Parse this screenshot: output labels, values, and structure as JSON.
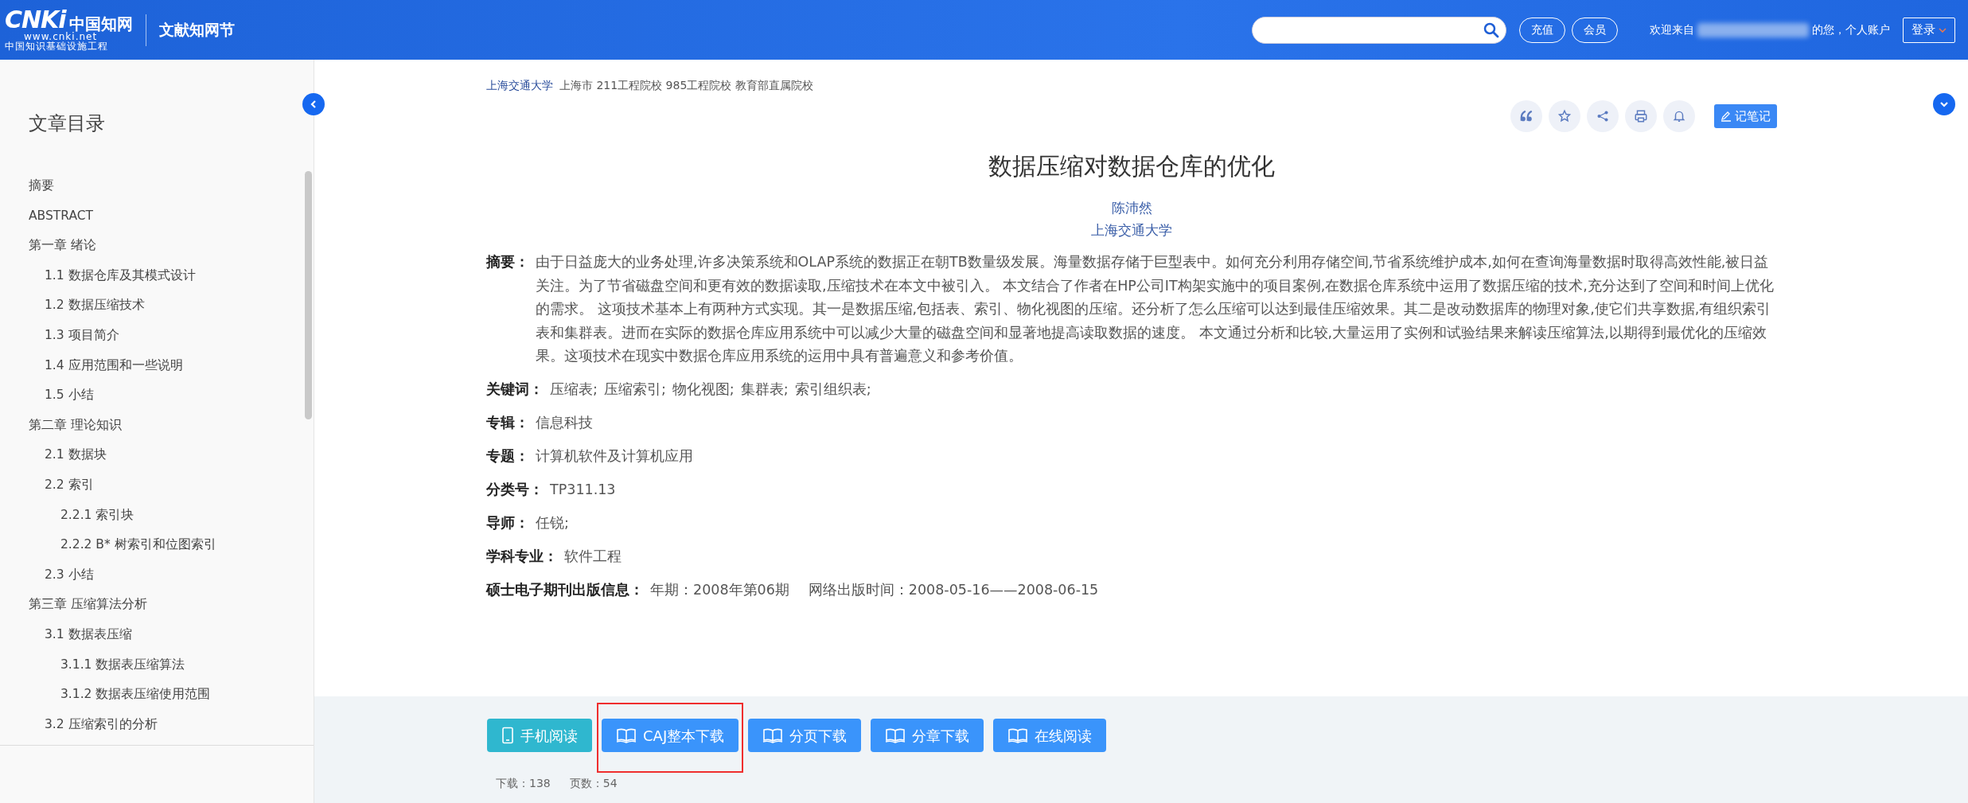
{
  "header": {
    "logo": {
      "mark": "CNKi",
      "name": "中国知网",
      "url": "www.cnki.net",
      "slogan": "中国知识基础设施工程"
    },
    "section": "文献知网节",
    "buttons": [
      "充值",
      "会员"
    ],
    "welcome": "欢迎来自",
    "welcome_suffix": "的您，个人账户",
    "login": "登录"
  },
  "sidebar": {
    "title": "文章目录",
    "items": [
      {
        "label": "摘要"
      },
      {
        "label": "ABSTRACT"
      },
      {
        "label": "第一章 绪论",
        "children": [
          {
            "label": "1.1 数据仓库及其模式设计"
          },
          {
            "label": "1.2 数据压缩技术"
          },
          {
            "label": "1.3 项目简介"
          },
          {
            "label": "1.4 应用范围和一些说明"
          },
          {
            "label": "1.5 小结"
          }
        ]
      },
      {
        "label": "第二章 理论知识",
        "children": [
          {
            "label": "2.1 数据块"
          },
          {
            "label": "2.2 索引",
            "children": [
              {
                "label": "2.2.1 索引块"
              },
              {
                "label": "2.2.2 B* 树索引和位图索引"
              }
            ]
          },
          {
            "label": "2.3 小结"
          }
        ]
      },
      {
        "label": "第三章 压缩算法分析",
        "children": [
          {
            "label": "3.1 数据表压缩",
            "children": [
              {
                "label": "3.1.1 数据表压缩算法"
              },
              {
                "label": "3.1.2 数据表压缩使用范围"
              }
            ]
          },
          {
            "label": "3.2 压缩索引的分析"
          }
        ]
      }
    ]
  },
  "article": {
    "institution": "上海交通大学",
    "tags": "上海市 211工程院校 985工程院校 教育部直属院校",
    "tools": [
      {
        "kind": "quote"
      },
      {
        "kind": "star"
      },
      {
        "kind": "share"
      },
      {
        "kind": "print"
      },
      {
        "kind": "bell"
      }
    ],
    "note_button": "记笔记",
    "title": "数据压缩对数据仓库的优化",
    "author": "陈沛然",
    "affiliation": "上海交通大学",
    "abstract_label": "摘要：",
    "abstract": "由于日益庞大的业务处理,许多决策系统和OLAP系统的数据正在朝TB数量级发展。海量数据存储于巨型表中。如何充分利用存储空间,节省系统维护成本,如何在查询海量数据时取得高效性能,被日益关注。为了节省磁盘空间和更有效的数据读取,压缩技术在本文中被引入。 本文结合了作者在HP公司IT构架实施中的项目案例,在数据仓库系统中运用了数据压缩的技术,充分达到了空间和时间上优化的需求。 这项技术基本上有两种方式实现。其一是数据压缩,包括表、索引、物化视图的压缩。还分析了怎么压缩可以达到最佳压缩效果。其二是改动数据库的物理对象,使它们共享数据,有组织索引表和集群表。进而在实际的数据仓库应用系统中可以减少大量的磁盘空间和显著地提高读取数据的速度。 本文通过分析和比较,大量运用了实例和试验结果来解读压缩算法,以期得到最优化的压缩效果。这项技术在现实中数据仓库应用系统的运用中具有普遍意义和参考价值。",
    "keywords_label": "关键词：",
    "keywords": [
      "压缩表;",
      "压缩索引;",
      "物化视图;",
      "集群表;",
      "索引组织表;"
    ],
    "meta": [
      {
        "label": "专辑：",
        "value": "信息科技"
      },
      {
        "label": "专题：",
        "value": "计算机软件及计算机应用"
      },
      {
        "label": "分类号：",
        "value": "TP311.13"
      },
      {
        "label": "导师：",
        "value": "任锐;"
      },
      {
        "label": "学科专业：",
        "value": "软件工程"
      }
    ],
    "publication": {
      "label": "硕士电子期刊出版信息：",
      "issue": "年期：2008年第06期",
      "online": "网络出版时间：2008-05-16——2008-06-15"
    }
  },
  "actions": [
    {
      "kind": "phone",
      "label": "手机阅读",
      "highlighted": false
    },
    {
      "kind": "book",
      "label": "CAJ整本下载",
      "highlighted": true
    },
    {
      "kind": "book",
      "label": "分页下载",
      "highlighted": false
    },
    {
      "kind": "book",
      "label": "分章下载",
      "highlighted": false
    },
    {
      "kind": "book",
      "label": "在线阅读",
      "highlighted": false
    }
  ],
  "stats": [
    "下载：138",
    "页数：54"
  ]
}
